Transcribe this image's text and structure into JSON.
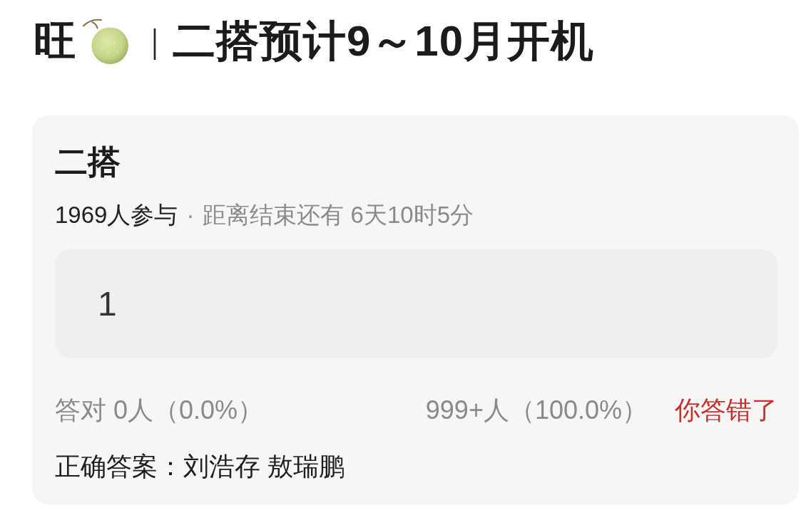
{
  "header": {
    "title_lead": "旺",
    "separator": "｜",
    "title": "二搭预计9～10月开机"
  },
  "quiz": {
    "title": "二搭",
    "participants": "1969人参与",
    "dot": "·",
    "time_left": "距离结束还有 6天10时5分",
    "answer": "1",
    "correct_stats": "答对 0人（0.0%）",
    "wrong_stats": "999+人（100.0%）",
    "result": "你答错了",
    "answered_correctly": false,
    "answer_key": "正确答案：刘浩存 敖瑞鹏"
  }
}
